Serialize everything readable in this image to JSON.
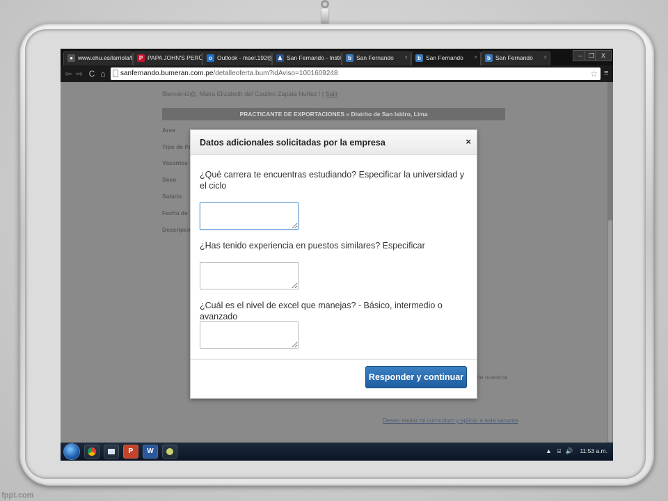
{
  "watermark": "fppt.com",
  "browser": {
    "tabs": [
      {
        "label": "www.ehu.es/larriola/E",
        "icon": "site-icon"
      },
      {
        "label": "PAPA JOHN'S PERÚ -",
        "icon": "papajohns-icon"
      },
      {
        "label": "Outlook - mael.192@",
        "icon": "outlook-icon"
      },
      {
        "label": "San Fernando - Institu",
        "icon": "school-icon"
      },
      {
        "label": "San Fernando",
        "icon": "bumeran-icon"
      },
      {
        "label": "San Fernando",
        "icon": "bumeran-icon"
      },
      {
        "label": "San Fernando",
        "icon": "bumeran-icon"
      }
    ],
    "url_host": "sanfernando.bumeran.com.pe",
    "url_path": "/detalleoferta.bum?idAviso=1001609248"
  },
  "page": {
    "welcome": "Bienvenid@, Maira Elizabeth del Cautivo  Zapata Nuñez !  |",
    "logout": "Salir",
    "job_title": "PRACTICANTE DE EXPORTACIONES » Distrito de San Isidro, Lima",
    "fields": [
      "Area",
      "Tipo de Pu",
      "Vacantes",
      "Sexo",
      "Salario",
      "Fecha de f",
      "Descripció"
    ],
    "side_note": "de nuestros",
    "apply_link": "Deseo enviar mi curriculum y aplicar a esta vacante"
  },
  "modal": {
    "title": "Datos adicionales solicitadas por la empresa",
    "close": "×",
    "questions": [
      "¿Qué carrera te encuentras estudiando? Especificar la universidad y el ciclo",
      "¿Has tenido experiencia en puestos similares? Especificar",
      "¿Cuál es el nivel de excel que manejas? - Básico, intermedio o avanzado"
    ],
    "submit": "Responder y continuar"
  },
  "taskbar": {
    "apps": [
      "chrome-icon",
      "files-icon",
      "P",
      "W",
      "paint-icon"
    ],
    "clock": "11:53 a.m."
  }
}
